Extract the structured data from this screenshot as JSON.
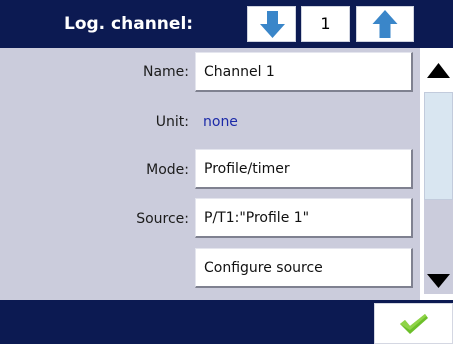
{
  "header": {
    "title": "Log. channel:",
    "channel_number": "1",
    "colors": {
      "background": "#0c1a52",
      "arrow": "#3a86c9"
    }
  },
  "form": {
    "name": {
      "label": "Name:",
      "value": "Channel 1"
    },
    "unit": {
      "label": "Unit:",
      "value": "none"
    },
    "mode": {
      "label": "Mode:",
      "value": "Profile/timer"
    },
    "source": {
      "label": "Source:",
      "value": "P/T1:\"Profile 1\""
    },
    "configure_source": {
      "label": "Configure source"
    }
  },
  "scrollbar": {
    "position_fraction": 0.0
  },
  "footer": {
    "confirm_icon": "checkmark-icon",
    "confirm_color": "#6cbf2a"
  }
}
